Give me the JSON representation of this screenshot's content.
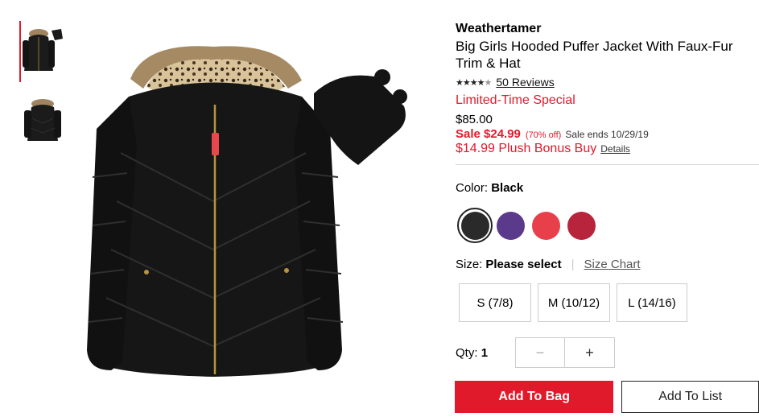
{
  "product": {
    "brand": "Weathertamer",
    "title": "Big Girls Hooded Puffer Jacket With Faux-Fur Trim & Hat",
    "rating": 4.5,
    "reviews_label": "50 Reviews",
    "promo": "Limited-Time Special",
    "original_price": "$85.00",
    "sale_price": "Sale $24.99",
    "sale_percent": "(70% off)",
    "sale_ends": "Sale ends 10/29/19",
    "bonus": "$14.99 Plush Bonus Buy",
    "details_label": "Details"
  },
  "color": {
    "label": "Color:",
    "selected": "Black",
    "swatches": [
      {
        "name": "Black",
        "hex": "#2a2a2a"
      },
      {
        "name": "Purple",
        "hex": "#5b3a8c"
      },
      {
        "name": "Red",
        "hex": "#e8404a"
      },
      {
        "name": "Dark Red",
        "hex": "#b8243b"
      }
    ]
  },
  "size": {
    "label": "Size:",
    "selected": "Please select",
    "chart_label": "Size Chart",
    "options": [
      "S (7/8)",
      "M (10/12)",
      "L (14/16)"
    ]
  },
  "qty": {
    "label": "Qty:",
    "value": "1",
    "minus": "−",
    "plus": "+"
  },
  "actions": {
    "add_to_bag": "Add To Bag",
    "add_to_list": "Add To List"
  },
  "icons": [
    "star-icon",
    "minus-icon",
    "plus-icon"
  ]
}
